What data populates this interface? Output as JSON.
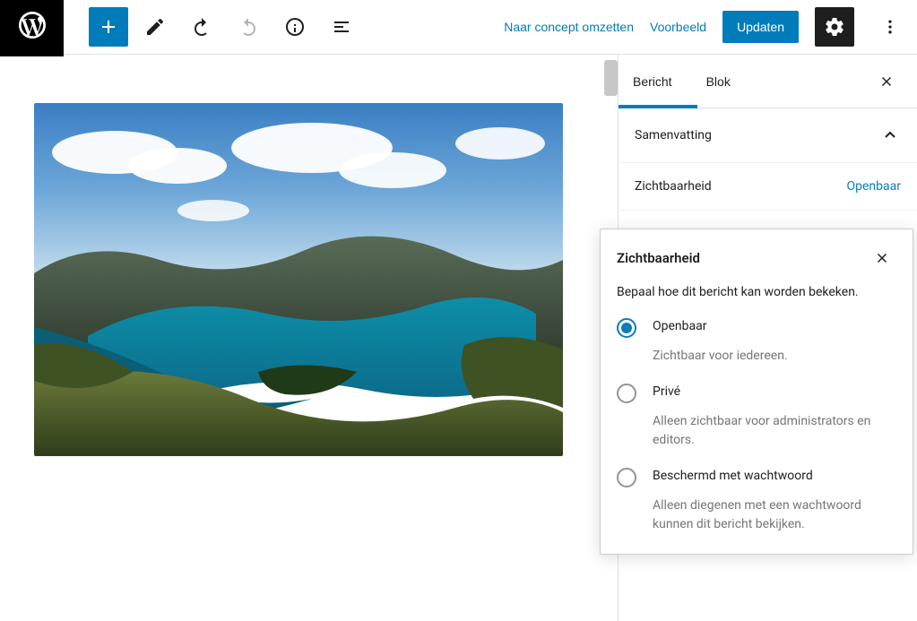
{
  "topbar": {
    "convert_to_draft": "Naar concept omzetten",
    "preview": "Voorbeeld",
    "update": "Updaten"
  },
  "sidebar": {
    "tabs": {
      "post": "Bericht",
      "block": "Blok"
    },
    "summary_header": "Samenvatting",
    "visibility_label": "Zichtbaarheid",
    "visibility_value": "Openbaar"
  },
  "popover": {
    "title": "Zichtbaarheid",
    "desc": "Bepaal hoe dit bericht kan worden bekeken.",
    "options": [
      {
        "label": "Openbaar",
        "desc": "Zichtbaar voor iedereen.",
        "checked": true
      },
      {
        "label": "Privé",
        "desc": "Alleen zichtbaar voor administrators en editors.",
        "checked": false
      },
      {
        "label": "Beschermd met wachtwoord",
        "desc": "Alleen diegenen met een wachtwoord kunnen dit bericht bekijken.",
        "checked": false
      }
    ]
  }
}
